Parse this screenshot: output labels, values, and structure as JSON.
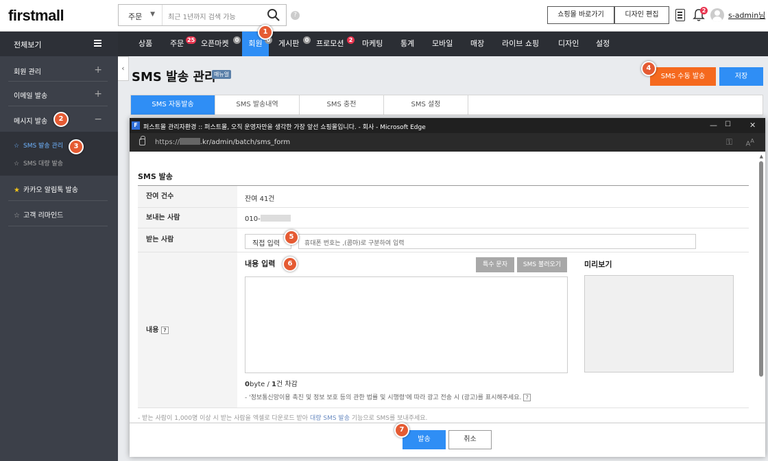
{
  "header": {
    "logo": "firstmall",
    "search_select": "주문",
    "search_placeholder": "최근 1년까지 검색 가능",
    "help": "?",
    "shop_button": "쇼핑몰 바로가기",
    "design_button": "디자인 편집",
    "notification_count": "2",
    "admin_user": "s-admin님"
  },
  "sidebar": {
    "title": "전체보기",
    "items": [
      {
        "label": "회원 관리",
        "toggle": "+"
      },
      {
        "label": "이메일 발송",
        "toggle": "+"
      },
      {
        "label": "메시지 발송",
        "toggle": "−"
      }
    ],
    "sub_items": [
      {
        "label": "SMS 발송 관리"
      },
      {
        "label": "SMS 대량 발송"
      }
    ],
    "kakao": "카카오 알림톡 발송",
    "remind": "고객 리마인드"
  },
  "nav": {
    "items": [
      {
        "label": "상품"
      },
      {
        "label": "주문",
        "badge": "25"
      },
      {
        "label": "오픈마켓",
        "badge": "0"
      },
      {
        "label": "회원",
        "badge": "0"
      },
      {
        "label": "게시판",
        "badge": "0"
      },
      {
        "label": "프로모션",
        "badge": "2"
      },
      {
        "label": "마케팅"
      },
      {
        "label": "통계"
      },
      {
        "label": "모바일"
      },
      {
        "label": "매장"
      },
      {
        "label": "라이브 쇼핑"
      },
      {
        "label": "디자인"
      },
      {
        "label": "설정"
      }
    ]
  },
  "page": {
    "title": "SMS 발송 관리",
    "manual_badge": "매뉴얼",
    "manual_send": "SMS 수동 발송",
    "save": "저장",
    "tabs": [
      "SMS 자동발송",
      "SMS 발송내역",
      "SMS 충전",
      "SMS 설정"
    ]
  },
  "popup": {
    "window_title": "퍼스트몰 관리자환경 :: 퍼스트몰, 오직 운영자만을 생각한 가장 앞선 쇼핑몰입니다. - 회사 - Microsoft Edge",
    "favicon": "F",
    "url_prefix": "https://",
    "url_suffix": ".kr/admin/batch/sms_form",
    "section_title": "SMS 발송",
    "rows": {
      "remaining_label": "잔여 건수",
      "remaining_value": "잔여 41건",
      "sender_label": "보내는 사람",
      "sender_value": "010-",
      "receiver_label": "받는 사람",
      "receiver_direct": "직접 입력",
      "receiver_placeholder": "휴대폰 번호는 ,(콤마)로 구분하여 입력",
      "content_label": "내용",
      "content_help": "?"
    },
    "content_title": "내용 입력",
    "special_chars": "특수 문자",
    "load_sms": "SMS 불러오기",
    "preview_title": "미리보기",
    "byte_num": "0",
    "byte_text": "byte / ",
    "count_num": "1",
    "count_text": "건 차감",
    "notice": "- '정보통신망이용 촉진 및 정보 보호 등의 관한 법률 및 시행령'에 따라 광고 전송 시 (광고)를 표시해주세요.",
    "bulk_note_prefix": "- 받는 사람이 1,000명 이상 시 받는 사람을 엑셀로 다운로드 받아 ",
    "bulk_note_link": "대량 SMS 발송",
    "bulk_note_suffix": " 기능으로 SMS를 보내주세요.",
    "send": "발송",
    "cancel": "취소"
  },
  "markers": [
    "1",
    "2",
    "3",
    "4",
    "5",
    "6",
    "7"
  ],
  "colors": {
    "accent_blue": "#2f8ef5",
    "accent_orange": "#f5691e",
    "marker": "#e55b33",
    "badge": "#e8344f",
    "sidebar": "#3c4049",
    "nav": "#2b2e34"
  }
}
